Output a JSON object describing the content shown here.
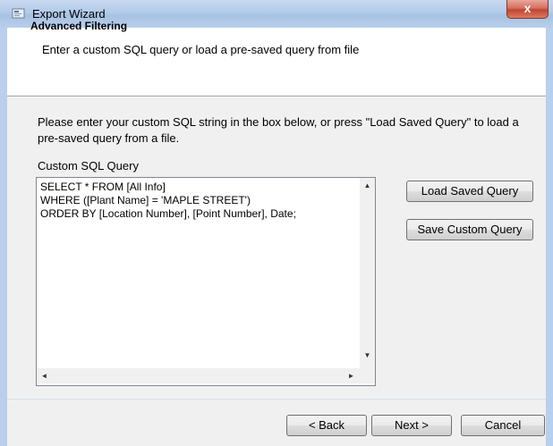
{
  "window": {
    "title": "Export Wizard",
    "close_label": "x"
  },
  "header": {
    "title": "Advanced Filtering",
    "subtitle": "Enter a custom SQL query or load a pre-saved query from file"
  },
  "body": {
    "description": "Please enter your custom SQL string in the box below, or press \"Load Saved Query\" to load a pre-saved query from a file.",
    "sql_label": "Custom SQL Query",
    "sql_value": "SELECT * FROM [All Info]\nWHERE ([Plant Name] = 'MAPLE STREET')\nORDER BY [Location Number], [Point Number], Date;"
  },
  "buttons": {
    "load": "Load Saved Query",
    "save": "Save Custom Query",
    "back": "< Back",
    "next": "Next >",
    "cancel": "Cancel"
  },
  "scroll": {
    "up": "▲",
    "down": "▼",
    "left": "◄",
    "right": "►"
  }
}
